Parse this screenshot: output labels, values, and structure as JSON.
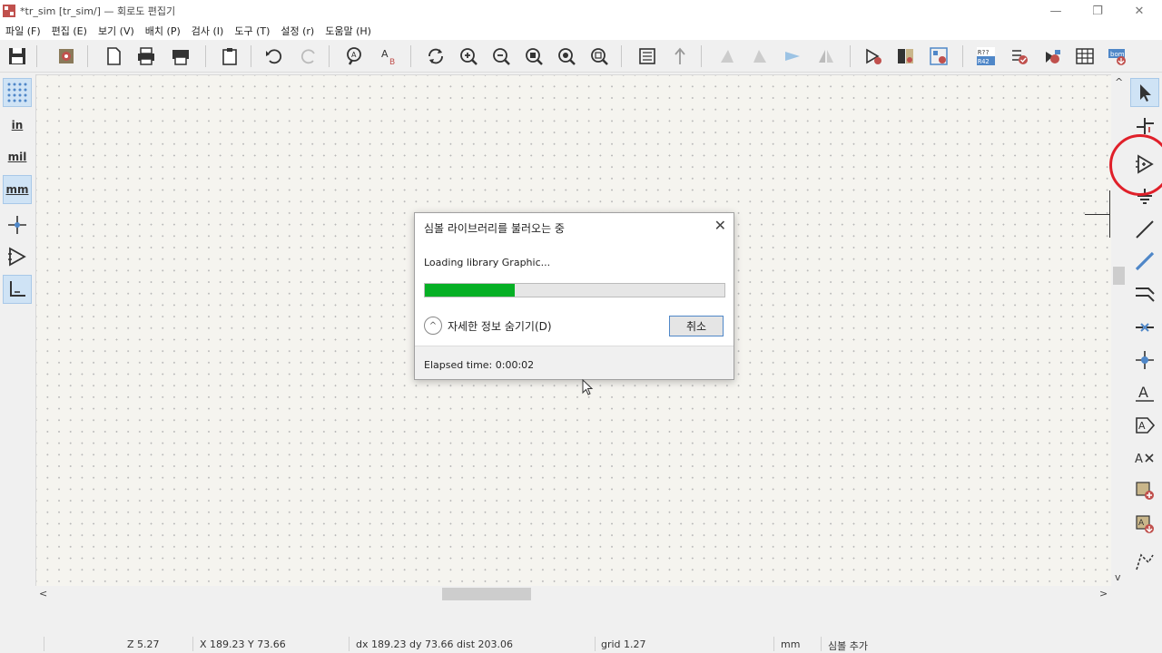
{
  "window": {
    "title": "*tr_sim [tr_sim/] — 회로도 편집기",
    "minimize_glyph": "—",
    "maximize_glyph": "❐",
    "close_glyph": "✕"
  },
  "menu": [
    {
      "label": "파일 (F)"
    },
    {
      "label": "편집 (E)"
    },
    {
      "label": "보기 (V)"
    },
    {
      "label": "배치 (P)"
    },
    {
      "label": "검사 (I)"
    },
    {
      "label": "도구 (T)"
    },
    {
      "label": "설정 (r)"
    },
    {
      "label": "도움말 (H)"
    }
  ],
  "left_toolbar": {
    "in_label": "in",
    "mil_label": "mil",
    "mm_label": "mm"
  },
  "right_toolbar": {
    "text_tool_label": "A"
  },
  "toolbar_icons": {
    "netlist_label_top": "R??",
    "netlist_label_bottom": "R42",
    "bom_label": "bom"
  },
  "dialog": {
    "title": "심볼 라이브러리를 불러오는 중",
    "close_glyph": "✕",
    "message": "Loading library Graphic...",
    "progress_percent": 30,
    "toggle_glyph": "^",
    "toggle_label": "자세한 정보 숨기기(D)",
    "cancel_label": "취소",
    "elapsed": "Elapsed time: 0:00:02"
  },
  "scrollbars": {
    "up": "^",
    "down": "v",
    "left": "<",
    "right": ">"
  },
  "status": {
    "zoom": "Z 5.27",
    "coords": "X 189.23  Y 73.66",
    "delta": "dx 189.23  dy 73.66  dist 203.06",
    "grid": "grid 1.27",
    "units": "mm",
    "mode": "심볼 추가"
  },
  "colors": {
    "progress_fill": "#06b025",
    "highlight_circle": "#e0202a",
    "accent": "#4f87c8"
  }
}
